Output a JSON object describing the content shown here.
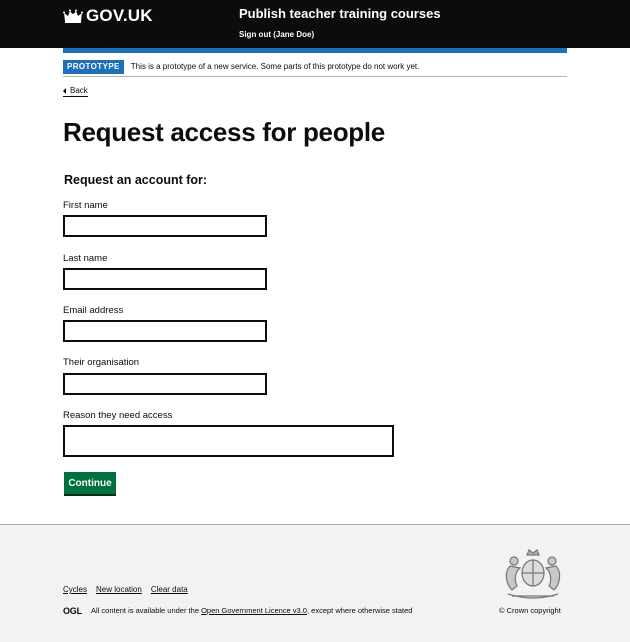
{
  "header": {
    "logo_text": "GOV.UK",
    "service_name": "Publish teacher training courses",
    "signout": "Sign out (Jane Doe)"
  },
  "phase_banner": {
    "tag": "PROTOTYPE",
    "text": "This is a prototype of a new service. Some parts of this prototype do not work yet."
  },
  "back_link": "Back",
  "page_title": "Request access for people",
  "form": {
    "legend": "Request an account for:",
    "fields": {
      "first_name": {
        "label": "First name",
        "value": ""
      },
      "last_name": {
        "label": "Last name",
        "value": ""
      },
      "email": {
        "label": "Email address",
        "value": ""
      },
      "organisation": {
        "label": "Their organisation",
        "value": ""
      },
      "reason": {
        "label": "Reason they need access",
        "value": ""
      }
    },
    "continue_label": "Continue"
  },
  "footer": {
    "links": [
      "Cycles",
      "New location",
      "Clear data"
    ],
    "ogl": "OGL",
    "licence_prefix": "All content is available under the ",
    "licence_link": "Open Government Licence v3.0",
    "licence_suffix": ", except where otherwise stated",
    "copyright": "© Crown copyright"
  },
  "colors": {
    "header_bg": "#0b0c0c",
    "brand_blue": "#1d70b8",
    "button_green": "#00703c",
    "footer_bg": "#f3f2f1"
  },
  "icons": {
    "logo": "crown-icon",
    "back": "chevron-left-icon",
    "footer": "royal-crest-icon"
  }
}
